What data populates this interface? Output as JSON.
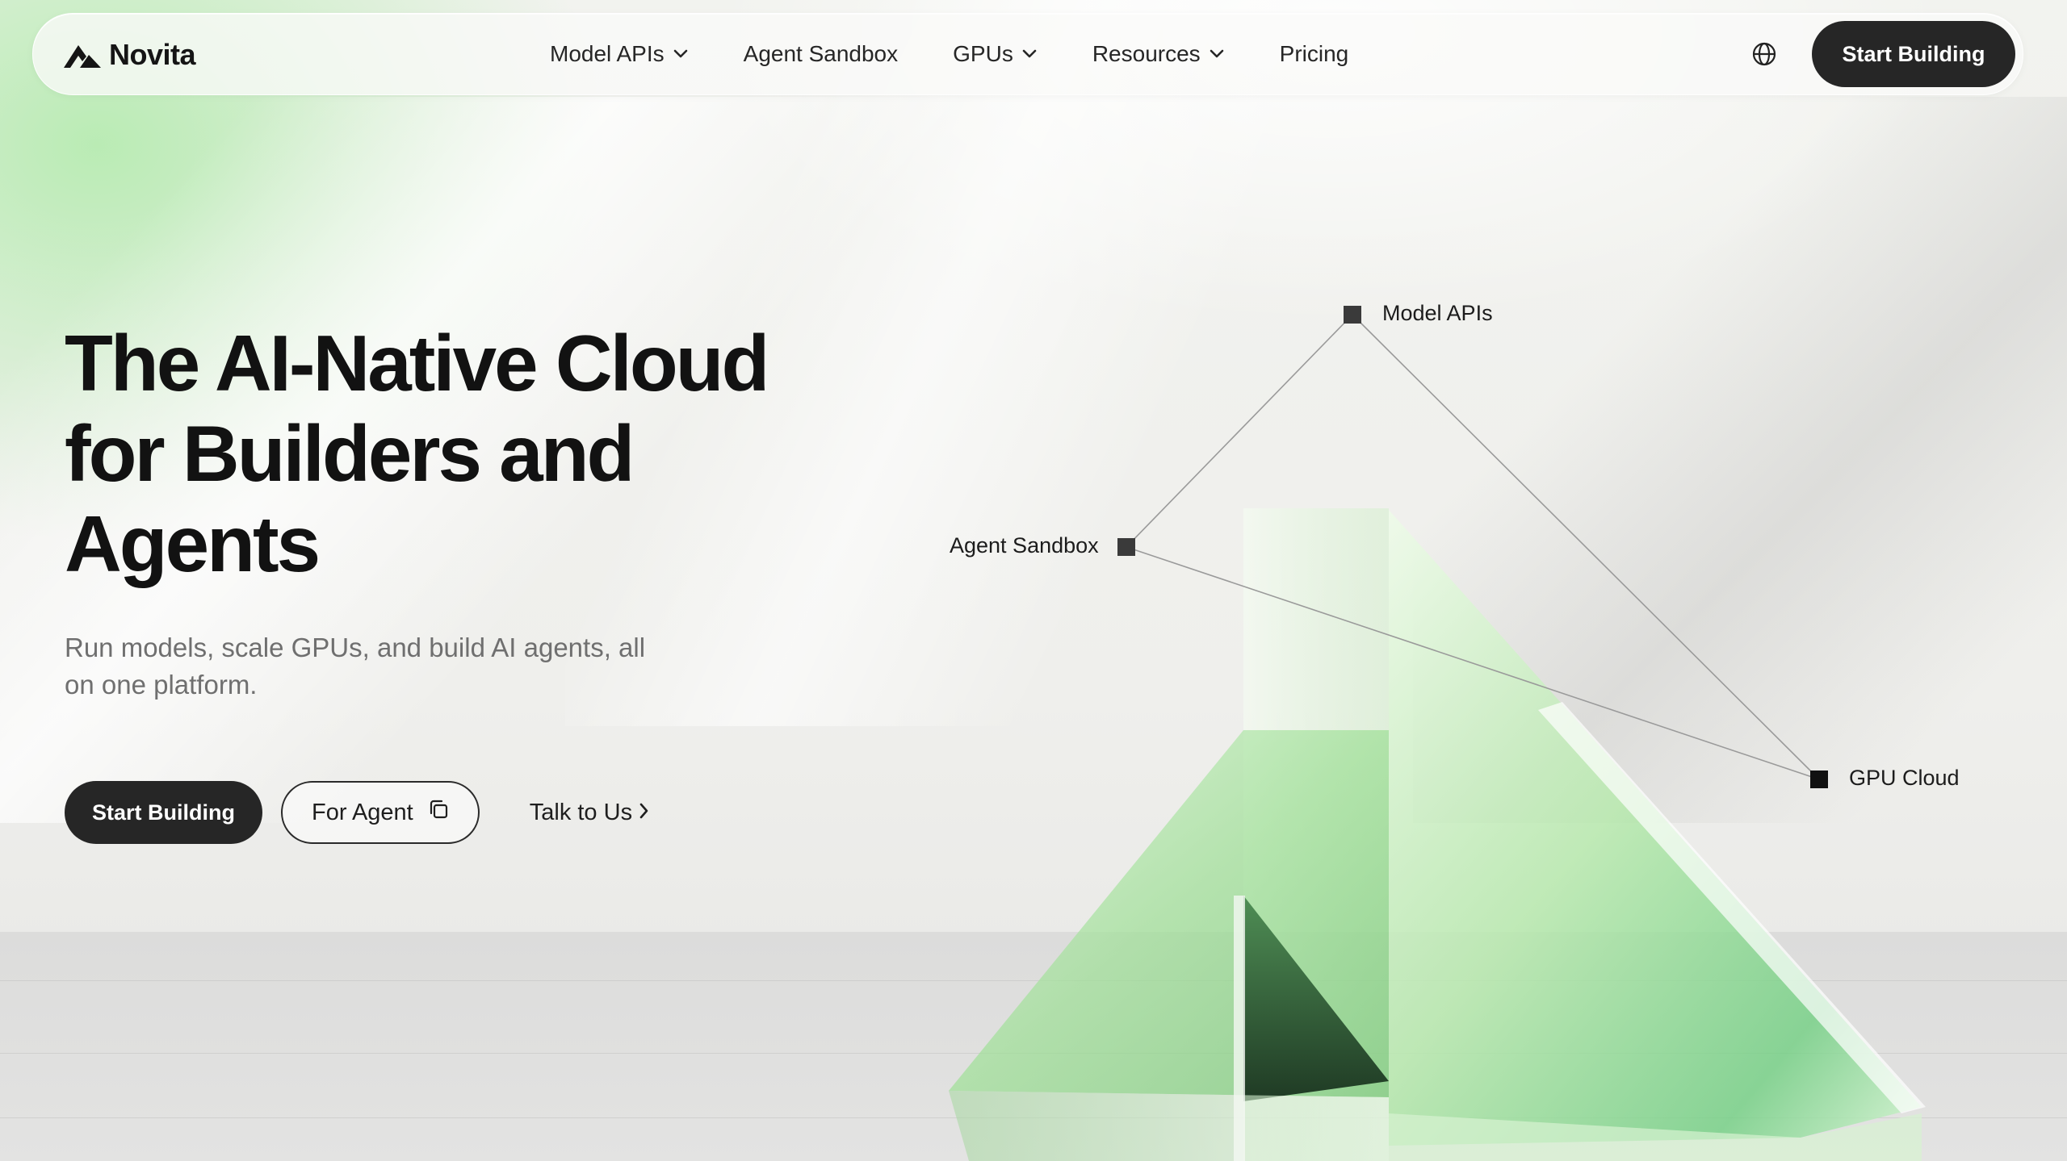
{
  "brand": {
    "name": "Novita",
    "logo_icon": "novita-logo-icon"
  },
  "nav": {
    "items": [
      {
        "label": "Model APIs",
        "has_dropdown": true
      },
      {
        "label": "Agent Sandbox",
        "has_dropdown": false
      },
      {
        "label": "GPUs",
        "has_dropdown": true
      },
      {
        "label": "Resources",
        "has_dropdown": true
      },
      {
        "label": "Pricing",
        "has_dropdown": false
      }
    ],
    "language_icon": "globe-icon",
    "cta_label": "Start Building"
  },
  "hero": {
    "title_lines": [
      "The AI-Native Cloud",
      "for Builders and",
      "Agents"
    ],
    "subtitle_lines": [
      "Run models, scale GPUs, and build AI agents, all",
      "on one platform."
    ],
    "primary_cta": "Start Building",
    "secondary_cta": "For Agent",
    "secondary_cta_icon": "copy-icon",
    "link_cta": "Talk to Us",
    "link_cta_icon": "chevron-right-icon"
  },
  "diagram": {
    "nodes": [
      {
        "id": "model-apis",
        "label": "Model APIs"
      },
      {
        "id": "agent-sandbox",
        "label": "Agent Sandbox"
      },
      {
        "id": "gpu-cloud",
        "label": "GPU Cloud"
      }
    ]
  },
  "colors": {
    "primary_dark": "#262626",
    "accent_green": "#8fd98a",
    "text_muted": "#6f6f6f"
  }
}
